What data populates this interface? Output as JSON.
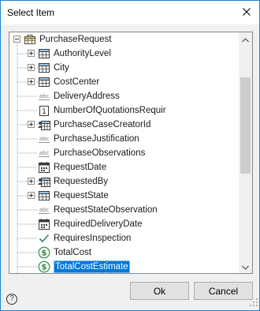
{
  "window": {
    "title": "Select Item"
  },
  "tree": {
    "root": {
      "label": "PurchaseRequest",
      "icon": "entity-icon",
      "expanded": true
    },
    "items": [
      {
        "label": "AuthorityLevel",
        "icon": "entity-table-icon",
        "expandable": true
      },
      {
        "label": "City",
        "icon": "entity-table-icon",
        "expandable": true
      },
      {
        "label": "CostCenter",
        "icon": "entity-table-icon",
        "expandable": true
      },
      {
        "label": "DeliveryAddress",
        "icon": "text-type-icon",
        "expandable": false
      },
      {
        "label": "NumberOfQuotationsRequir",
        "icon": "integer-type-icon",
        "expandable": false
      },
      {
        "label": "PurchaseCaseCreatorId",
        "icon": "user-table-icon",
        "expandable": true
      },
      {
        "label": "PurchaseJustification",
        "icon": "text-type-icon",
        "expandable": false
      },
      {
        "label": "PurchaseObservations",
        "icon": "text-type-icon",
        "expandable": false
      },
      {
        "label": "RequestDate",
        "icon": "date-type-icon",
        "expandable": false
      },
      {
        "label": "RequestedBy",
        "icon": "user-table-icon",
        "expandable": true
      },
      {
        "label": "RequestState",
        "icon": "entity-table-icon",
        "expandable": true
      },
      {
        "label": "RequestStateObservation",
        "icon": "text-type-icon",
        "expandable": false
      },
      {
        "label": "RequiredDeliveryDate",
        "icon": "date-type-icon",
        "expandable": false
      },
      {
        "label": "RequiresInspection",
        "icon": "boolean-check-icon",
        "expandable": false
      },
      {
        "label": "TotalCost",
        "icon": "currency-type-icon",
        "expandable": false
      },
      {
        "label": "TotalCostEstimate",
        "icon": "currency-type-icon",
        "expandable": false,
        "selected": true
      }
    ]
  },
  "icon_text": {
    "abc": "abc",
    "int": "1"
  },
  "buttons": {
    "ok": "Ok",
    "cancel": "Cancel",
    "help": "?"
  },
  "scrollbar": {
    "position": 0.25,
    "visible_fraction": 0.45
  },
  "colors": {
    "selection": "#0078d7",
    "window_border": "#1883d7",
    "icon_green": "#2e8b57"
  }
}
